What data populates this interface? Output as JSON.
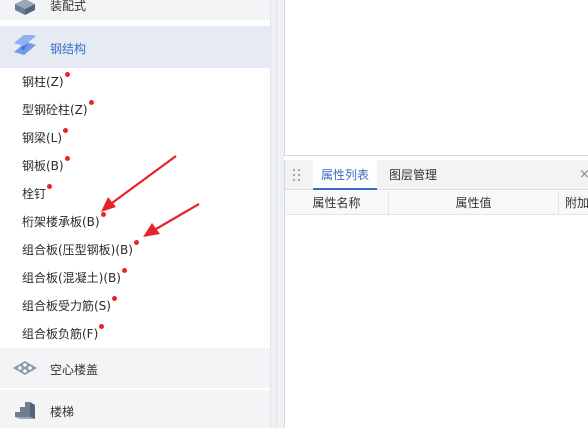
{
  "nav": {
    "cat_top": {
      "label": "装配式",
      "icon": "prefab-component-icon"
    },
    "cat_steel": {
      "label": "钢结构",
      "icon": "steel-beam-icon"
    },
    "items": [
      {
        "label": "钢柱(Z)"
      },
      {
        "label": "型钢砼柱(Z)"
      },
      {
        "label": "钢梁(L)"
      },
      {
        "label": "钢板(B)"
      },
      {
        "label": "栓钉"
      },
      {
        "label": "桁架楼承板(B)"
      },
      {
        "label": "组合板(压型钢板)(B)"
      },
      {
        "label": "组合板(混凝土)(B)"
      },
      {
        "label": "组合板受力筋(S)"
      },
      {
        "label": "组合板负筋(F)"
      }
    ],
    "cat_hollow": {
      "label": "空心楼盖",
      "icon": "hollow-slab-icon"
    },
    "cat_stairs": {
      "label": "楼梯",
      "icon": "stairs-icon"
    }
  },
  "properties": {
    "tabs": [
      {
        "label": "属性列表"
      },
      {
        "label": "图层管理"
      }
    ],
    "close_label": "×",
    "columns": [
      {
        "label": "属性名称"
      },
      {
        "label": "属性值"
      },
      {
        "label": "附加"
      }
    ]
  },
  "colors": {
    "accent": "#3a6cc8",
    "marker_dot": "#e8242b",
    "arrow": "#e8242b"
  }
}
